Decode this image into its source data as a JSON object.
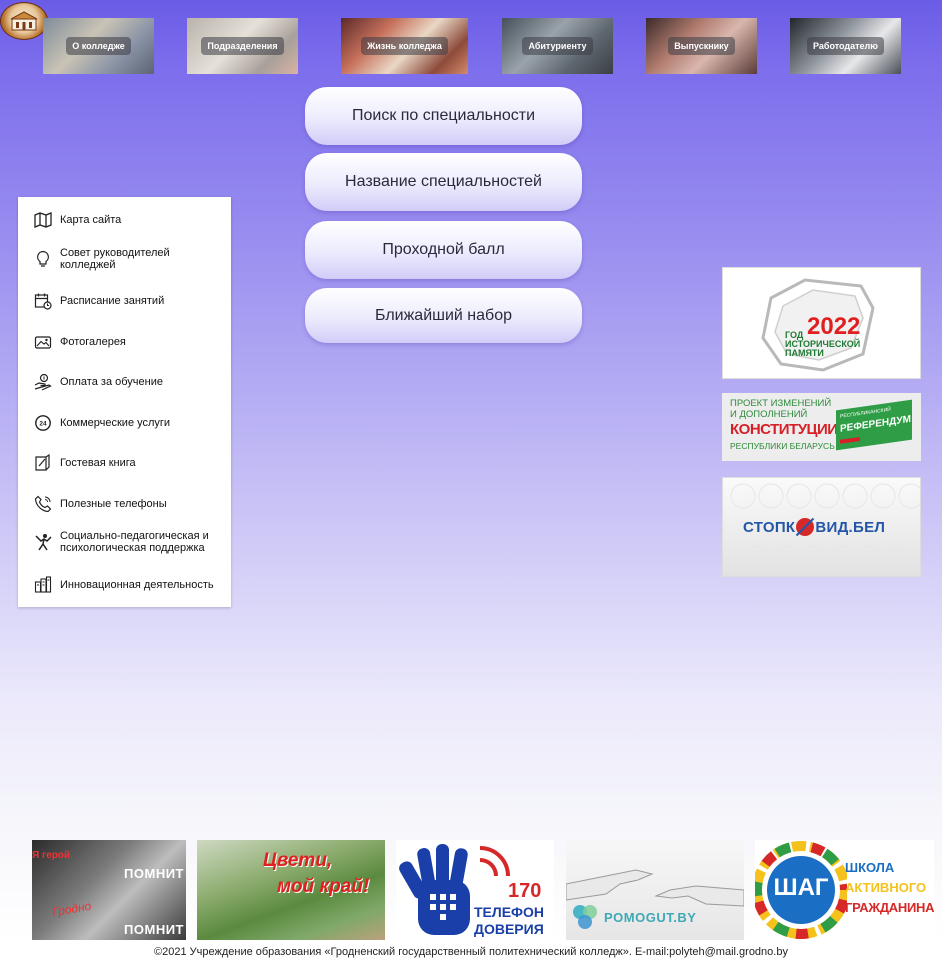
{
  "header": {
    "logo": "college-emblem",
    "nav": [
      {
        "label": "О колледже",
        "icon": "college-building-photo"
      },
      {
        "label": "Подразделения",
        "icon": "departments-photo"
      },
      {
        "label": "Жизнь колледжа",
        "icon": "college-life-photo"
      },
      {
        "label": "Абитуриенту",
        "icon": "applicant-photo"
      },
      {
        "label": "Выпускнику",
        "icon": "graduate-photo"
      },
      {
        "label": "Работодателю",
        "icon": "employer-photo"
      }
    ]
  },
  "main": {
    "buttons": [
      {
        "label": "Поиск по специальности"
      },
      {
        "label": "Название специальностей"
      },
      {
        "label": "Проходной балл"
      },
      {
        "label": "Ближайший набор"
      }
    ]
  },
  "sidebar": {
    "items": [
      {
        "label": "Карта сайта",
        "icon": "map-icon"
      },
      {
        "label": "Совет руководителей колледжей",
        "icon": "lightbulb-icon"
      },
      {
        "label": "Расписание занятий",
        "icon": "calendar-icon"
      },
      {
        "label": "Фотогалерея",
        "icon": "photo-icon"
      },
      {
        "label": "Оплата за обучение",
        "icon": "payment-icon"
      },
      {
        "label": "Коммерческие услуги",
        "icon": "24h-service-icon"
      },
      {
        "label": "Гостевая книга",
        "icon": "guestbook-icon"
      },
      {
        "label": "Полезные телефоны",
        "icon": "phone-icon"
      },
      {
        "label": "Социально-педагогическая и психологическая поддержка",
        "icon": "support-icon"
      },
      {
        "label": "Инновационная деятельность",
        "icon": "innovation-icon"
      }
    ]
  },
  "right_banners": {
    "year": {
      "line1": "ГОД",
      "line2": "ИСТОРИЧЕСКОЙ",
      "line3": "ПАМЯТИ",
      "number": "2022"
    },
    "constitution": {
      "line1": "ПРОЕКТ ИЗМЕНЕНИЙ",
      "line2": "И ДОПОЛНЕНИЙ",
      "line3": "КОНСТИТУЦИИ",
      "line4": "РЕСПУБЛИКИ БЕЛАРУСЬ",
      "badge_small": "РЕСПУБЛИКАНСКИЙ",
      "badge_big": "РЕФЕРЕНДУМ"
    },
    "covid": {
      "part1": "СТОПК",
      "part2": "ВИД.БЕЛ"
    }
  },
  "bottom_banners": {
    "hero": {
      "line1": "Я герой",
      "line2": "ПОМНИТ",
      "script": "Гродно"
    },
    "flower": {
      "line1": "Цвети,",
      "line2": "мой край!"
    },
    "helpline": {
      "number": "170",
      "line1": "ТЕЛЕФОН",
      "line2": "ДОВЕРИЯ"
    },
    "pomogut": {
      "text": "POMOGUT.BY"
    },
    "shag": {
      "logo": "ШАГ",
      "line1": "ШКОЛА",
      "line2": "АКТИВНОГО",
      "line3": "ГРАЖДАНИНА"
    }
  },
  "footer": {
    "text": "©2021 Учреждение образования «Гродненский государственный политехнический колледж». E-mail:polyteh@mail.grodno.by"
  },
  "colors": {
    "accent": "#6a5ce6",
    "red": "#e02020",
    "green": "#2e8b3a",
    "blue": "#1a3fa8"
  }
}
